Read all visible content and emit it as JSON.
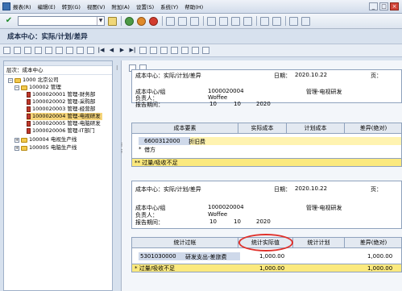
{
  "menu": {
    "items": [
      "报表(R)",
      "编辑(E)",
      "转到(G)",
      "视图(V)",
      "附加(A)",
      "设置(S)",
      "系统(Y)",
      "帮助(H)"
    ]
  },
  "system_toolbar": {
    "command_field_value": "",
    "icons": [
      "enter-icon",
      "save-icon",
      "back-icon",
      "exit-icon",
      "cancel-icon",
      "print-icon",
      "find-icon",
      "find-next-icon"
    ]
  },
  "title": "成本中心：实际/计划/差异",
  "left_panel": {
    "header": "层次：成本中心",
    "tree": [
      {
        "label": "1000 北京公司",
        "level": 0,
        "type": "folder",
        "expanded": true
      },
      {
        "label": "100002 管理",
        "level": 1,
        "type": "folder",
        "expanded": true
      },
      {
        "label": "1000020001 管理-财务部",
        "level": 2,
        "type": "leaf"
      },
      {
        "label": "1000020002 管理-采购部",
        "level": 2,
        "type": "leaf"
      },
      {
        "label": "1000020003 管理-经营部",
        "level": 2,
        "type": "leaf"
      },
      {
        "label": "1000020004 管理-电视研发",
        "level": 2,
        "type": "leaf",
        "selected": true
      },
      {
        "label": "1000020005 管理-电脑研发",
        "level": 2,
        "type": "leaf"
      },
      {
        "label": "1000020006 管理-IT部门",
        "level": 2,
        "type": "leaf"
      },
      {
        "label": "100004 电视生产线",
        "level": 1,
        "type": "folder",
        "expanded": false
      },
      {
        "label": "100005 电脑生产线",
        "level": 1,
        "type": "folder",
        "expanded": false
      }
    ]
  },
  "report1": {
    "title": "成本中心：实际/计划/差异",
    "date_label": "日期：",
    "date": "2020.10.22",
    "page_label": "页：",
    "cc_label": "成本中心/组",
    "cc_value": "1000020004",
    "cc_desc": "管理-电视研发",
    "owner_label": "负责人：",
    "owner_value": "Woffee",
    "period_label": "报告期间：",
    "period_from": "10",
    "period_to": "10",
    "year": "2020",
    "columns": [
      "成本要素",
      "实际成本",
      "计划成本",
      "差异(绝对)"
    ],
    "row_code": "6600312000",
    "row_desc": "折旧费",
    "debit_label": "借方",
    "total_label": "** 过量/吸收不足"
  },
  "report2": {
    "title": "成本中心：实际/计划/差异",
    "date_label": "日期：",
    "date": "2020.10.22",
    "page_label": "页：",
    "cc_label": "成本中心/组",
    "cc_value": "1000020004",
    "cc_desc": "管理-电视研发",
    "owner_label": "负责人：",
    "owner_value": "Woffee",
    "period_label": "报告期间：",
    "period_from": "10",
    "period_to": "10",
    "year": "2020",
    "columns": [
      "统计过帐",
      "统计实际值",
      "统计计划",
      "差异(绝对)"
    ],
    "row_code": "5301030000",
    "row_desc": "研发支出-差旅费",
    "row_actual": "1,000.00",
    "row_variance": "1,000.00",
    "total_label": "* 过量/吸收不足",
    "total_actual": "1,000.00",
    "total_variance": "1,000.00"
  },
  "colors": {
    "highlight_oval": "#e0302a",
    "total_row": "#fbe97e",
    "selected_node": "#f6d57a"
  }
}
